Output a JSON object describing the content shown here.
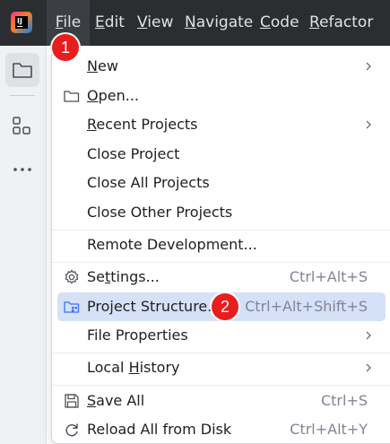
{
  "menubar": {
    "items": [
      {
        "label_pre": "",
        "mnemonic": "F",
        "label_post": "ile"
      },
      {
        "label_pre": "",
        "mnemonic": "E",
        "label_post": "dit"
      },
      {
        "label_pre": "",
        "mnemonic": "V",
        "label_post": "iew"
      },
      {
        "label_pre": "",
        "mnemonic": "N",
        "label_post": "avigate"
      },
      {
        "label_pre": "",
        "mnemonic": "C",
        "label_post": "ode"
      },
      {
        "label_pre": "",
        "mnemonic": "R",
        "label_post": "efactor"
      }
    ]
  },
  "file_menu": {
    "new": {
      "pre": "",
      "u": "N",
      "post": "ew"
    },
    "open": {
      "pre": "",
      "u": "O",
      "post": "pen..."
    },
    "recent": {
      "pre": "",
      "u": "R",
      "post": "ecent Projects"
    },
    "close_project": "Close Project",
    "close_all": "Close All Projects",
    "close_other": "Close Other Projects",
    "remote_dev": "Remote Development...",
    "settings": {
      "pre": "Se",
      "u": "t",
      "post": "tings...",
      "shortcut": "Ctrl+Alt+S"
    },
    "project_structure": {
      "label": "Project Structure...",
      "shortcut": "Ctrl+Alt+Shift+S"
    },
    "file_properties": "File Properties",
    "local_history": {
      "pre": "Local ",
      "u": "H",
      "post": "istory"
    },
    "save_all": {
      "pre": "",
      "u": "S",
      "post": "ave All",
      "shortcut": "Ctrl+S"
    },
    "reload": {
      "label": "Reload All from Disk",
      "shortcut": "Ctrl+Alt+Y"
    }
  },
  "badges": {
    "first": "1",
    "second": "2"
  },
  "colors": {
    "menubar_bg": "#2b2d30",
    "selection_bg": "#d5e1f7",
    "badge": "#e81e1e"
  }
}
